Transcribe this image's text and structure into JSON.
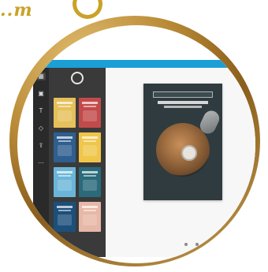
{
  "colors": {
    "gold": "#c9a227",
    "topbar": "#1a9fd6",
    "rail": "#2a2a2a",
    "panel": "#3a3a3a",
    "canvas": "#f7f7f7"
  },
  "header": {
    "title": "",
    "menu": ""
  },
  "left_rail": {
    "items": [
      {
        "name": "templates-icon"
      },
      {
        "name": "photos-icon"
      },
      {
        "name": "text-icon"
      },
      {
        "name": "shapes-icon"
      },
      {
        "name": "upload-icon"
      },
      {
        "name": "more-icon"
      }
    ]
  },
  "templates_panel": {
    "header_left": "",
    "header_right": "",
    "thumbnails": [
      {
        "name": "template-thumb-1",
        "color": "#e6c05a"
      },
      {
        "name": "template-thumb-2",
        "color": "#c34a4a"
      },
      {
        "name": "template-thumb-3",
        "color": "#2f5e8f"
      },
      {
        "name": "template-thumb-4",
        "color": "#f0c64a"
      },
      {
        "name": "template-thumb-5",
        "color": "#6bb6d8"
      },
      {
        "name": "template-thumb-6",
        "color": "#2a6a7a"
      },
      {
        "name": "template-thumb-7",
        "color": "#1c4f7a"
      },
      {
        "name": "template-thumb-8",
        "color": "#e7b7a7"
      }
    ]
  },
  "canvas": {
    "document": {
      "ribbon_text": "",
      "title_line_1": "",
      "title_line_2": ""
    }
  }
}
